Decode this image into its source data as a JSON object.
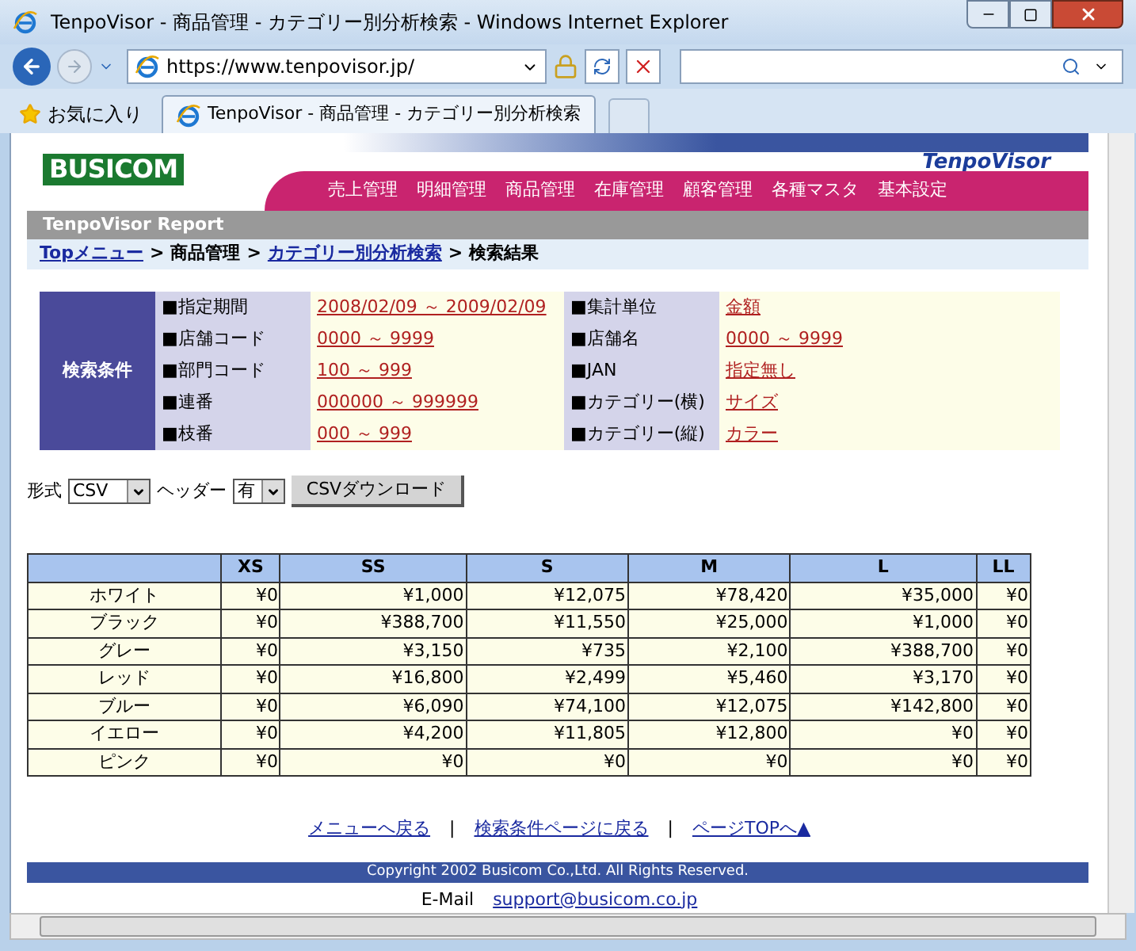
{
  "window": {
    "title": "TenpoVisor - 商品管理 - カテゴリー別分析検索 - Windows Internet Explorer"
  },
  "address": {
    "url": "https://www.tenpovisor.jp/"
  },
  "favorites": {
    "label": "お気に入り"
  },
  "tabs": [
    {
      "label": "TenpoVisor - 商品管理 - カテゴリー別分析検索",
      "selected": true
    }
  ],
  "header": {
    "logo": "BUSICOM",
    "brand": "TenpoVisor"
  },
  "nav": [
    "売上管理",
    "明細管理",
    "商品管理",
    "在庫管理",
    "顧客管理",
    "各種マスタ",
    "基本設定"
  ],
  "report_bar": "TenpoVisor Report",
  "breadcrumb": {
    "separator": ">",
    "items": [
      {
        "label": "Topメニュー",
        "link": true
      },
      {
        "label": "商品管理",
        "link": false
      },
      {
        "label": "カテゴリー別分析検索",
        "link": true
      },
      {
        "label": "検索結果",
        "link": false
      }
    ]
  },
  "conditions": {
    "heading": "検索条件",
    "rows": [
      {
        "label": "■指定期間",
        "value": "2008/02/09 ～ 2009/02/09",
        "label_2": "■集計単位",
        "value_2": "金額"
      },
      {
        "label": "■店舗コード",
        "value": "0000 ～ 9999",
        "label_2": "■店舗名",
        "value_2": "0000 ～ 9999"
      },
      {
        "label": "■部門コード",
        "value": "100 ～ 999",
        "label_2": "■JAN",
        "value_2": "指定無し"
      },
      {
        "label": "■連番",
        "value": "000000 ～ 999999",
        "label_2": "■カテゴリー(横)",
        "value_2": "サイズ"
      },
      {
        "label": "■枝番",
        "value": "000 ～ 999",
        "label_2": "■カテゴリー(縦)",
        "value_2": "カラー"
      }
    ]
  },
  "export": {
    "format_label": "形式",
    "format": "CSV",
    "header_label": "ヘッダー",
    "header": "有",
    "button": "CSVダウンロード"
  },
  "table": {
    "columns": [
      "XS",
      "SS",
      "S",
      "M",
      "L",
      "LL"
    ],
    "rows": [
      {
        "label": "ホワイト",
        "values": [
          "¥0",
          "¥1,000",
          "¥12,075",
          "¥78,420",
          "¥35,000",
          "¥0"
        ]
      },
      {
        "label": "ブラック",
        "values": [
          "¥0",
          "¥388,700",
          "¥11,550",
          "¥25,000",
          "¥1,000",
          "¥0"
        ]
      },
      {
        "label": "グレー",
        "values": [
          "¥0",
          "¥3,150",
          "¥735",
          "¥2,100",
          "¥388,700",
          "¥0"
        ]
      },
      {
        "label": "レッド",
        "values": [
          "¥0",
          "¥16,800",
          "¥2,499",
          "¥5,460",
          "¥3,170",
          "¥0"
        ]
      },
      {
        "label": "ブルー",
        "values": [
          "¥0",
          "¥6,090",
          "¥74,100",
          "¥12,075",
          "¥142,800",
          "¥0"
        ]
      },
      {
        "label": "イエロー",
        "values": [
          "¥0",
          "¥4,200",
          "¥11,805",
          "¥12,800",
          "¥0",
          "¥0"
        ]
      },
      {
        "label": "ピンク",
        "values": [
          "¥0",
          "¥0",
          "¥0",
          "¥0",
          "¥0",
          "¥0"
        ]
      }
    ]
  },
  "footer": {
    "separator": "|",
    "links": [
      "メニューへ戻る",
      "検索条件ページに戻る",
      "ページTOPへ▲"
    ],
    "copyright": "Copyright 2002 Busicom Co.,Ltd. All Rights Reserved.",
    "email_label": "E-Mail",
    "email": "support@busicom.co.jp"
  }
}
